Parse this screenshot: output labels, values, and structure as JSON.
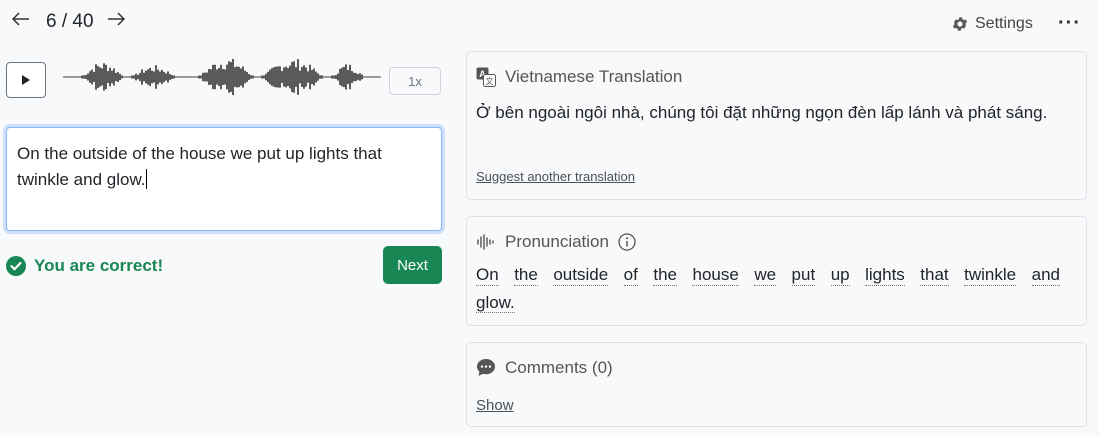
{
  "nav": {
    "prev_icon": "arrow-left-icon",
    "next_icon": "arrow-right-icon",
    "counter": "6 / 40",
    "settings_label": "Settings",
    "more_label": "···"
  },
  "player": {
    "speed_label": "1x"
  },
  "answer": {
    "text": "On the outside of the house we put up lights that twinkle and glow."
  },
  "feedback": {
    "message": "You are correct!",
    "next_label": "Next",
    "success_color": "#198754"
  },
  "translation": {
    "heading": "Vietnamese Translation",
    "text": "Ở bên ngoài ngôi nhà, chúng tôi đặt những ngọn đèn lấp lánh và phát sáng.",
    "suggest_link": "Suggest another translation"
  },
  "pronunciation": {
    "heading": "Pronunciation",
    "words": [
      "On",
      "the",
      "outside",
      "of",
      "the",
      "house",
      "we",
      "put",
      "up",
      "lights",
      "that",
      "twinkle",
      "and",
      "glow."
    ]
  },
  "comments": {
    "heading": "Comments (0)",
    "show_link": "Show"
  }
}
